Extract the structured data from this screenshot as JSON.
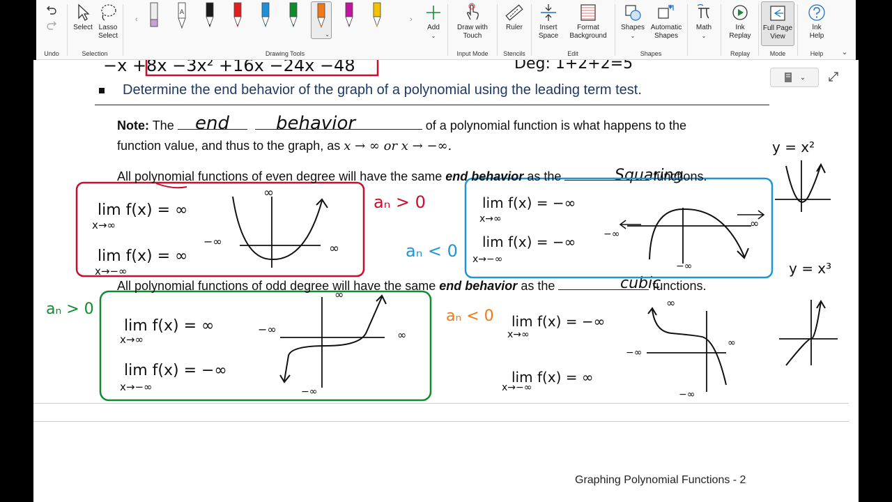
{
  "ribbon": {
    "undo": {
      "group_label": "Undo"
    },
    "selection": {
      "select_label": "Select",
      "lasso_label": "Lasso\nSelect",
      "group_label": "Selection"
    },
    "drawing_tools": {
      "group_label": "Drawing Tools",
      "add_label": "Add",
      "pens": [
        {
          "name": "eraser",
          "color": "#c9a0dc"
        },
        {
          "name": "pencil",
          "color": "#888888"
        },
        {
          "name": "black",
          "color": "#1a1a1a"
        },
        {
          "name": "red",
          "color": "#e02020"
        },
        {
          "name": "blue",
          "color": "#1e90d8"
        },
        {
          "name": "green",
          "color": "#0f8a2f"
        },
        {
          "name": "orange",
          "color": "#f07a1a"
        },
        {
          "name": "purple",
          "color": "#c0169c"
        },
        {
          "name": "yellow",
          "color": "#f2c200"
        }
      ]
    },
    "input_mode": {
      "draw_touch_label": "Draw with\nTouch",
      "group_label": "Input Mode"
    },
    "stencils": {
      "ruler_label": "Ruler",
      "group_label": "Stencils"
    },
    "edit": {
      "insert_space_label": "Insert\nSpace",
      "format_bg_label": "Format\nBackground",
      "group_label": "Edit"
    },
    "shapes": {
      "shapes_label": "Shapes",
      "auto_shapes_label": "Automatic\nShapes",
      "group_label": "Shapes"
    },
    "math": {
      "math_label": "Math"
    },
    "replay": {
      "ink_replay_label": "Ink\nReplay",
      "group_label": "Replay"
    },
    "mode": {
      "full_page_label": "Full Page\nView",
      "group_label": "Mode"
    },
    "help": {
      "ink_help_label": "Ink\nHelp",
      "group_label": "Help"
    }
  },
  "page": {
    "heading": "Determine the end behavior of the graph of a polynomial using the leading term test.",
    "note_label": "Note:",
    "note_the": "The",
    "note_rest": "of a polynomial function is what happens to the",
    "note_line2": "function value, and thus to the graph, as",
    "note_math": "x  → ∞ or x → −∞.",
    "even_prefix": "All polynomial functions of even degree will have the same",
    "end_behavior_term": "end behavior",
    "even_mid": "as the",
    "even_suffix": "functions.",
    "odd_prefix": "All polynomial functions of odd degree will have the same",
    "odd_mid": "as the",
    "odd_suffix": "functions.",
    "footer": "Graphing Polynomial Functions - 2"
  },
  "ink": {
    "top_partial": "−x  +8x −3x² +16x −24x −48",
    "top_right_partial": "Deg: 1+2+2=5",
    "blank1": "end",
    "blank2": "behavior",
    "blank3": "Squaring",
    "blank4": "cubic",
    "ref1": "y = x²",
    "ref2": "y = x³",
    "even_pos": {
      "cond": "aₙ > 0",
      "lim1": "lim f(x) = ∞",
      "sub1": "x→∞",
      "lim2": "lim f(x) = ∞",
      "sub2": "x→−∞"
    },
    "even_neg": {
      "cond": "aₙ < 0",
      "lim1": "lim f(x) = −∞",
      "sub1": "x→∞",
      "lim2": "lim f(x) = −∞",
      "sub2": "x→−∞"
    },
    "odd_pos": {
      "cond": "aₙ > 0",
      "lim1": "lim f(x) = ∞",
      "sub1": "x→∞",
      "lim2": "lim f(x) = −∞",
      "sub2": "x→−∞"
    },
    "odd_neg": {
      "cond": "aₙ < 0",
      "lim1": "lim f(x) = −∞",
      "sub1": "x→∞",
      "lim2": "lim f(x) = ∞",
      "sub2": "x→−∞"
    },
    "inf": "∞",
    "neg_inf": "−∞"
  }
}
